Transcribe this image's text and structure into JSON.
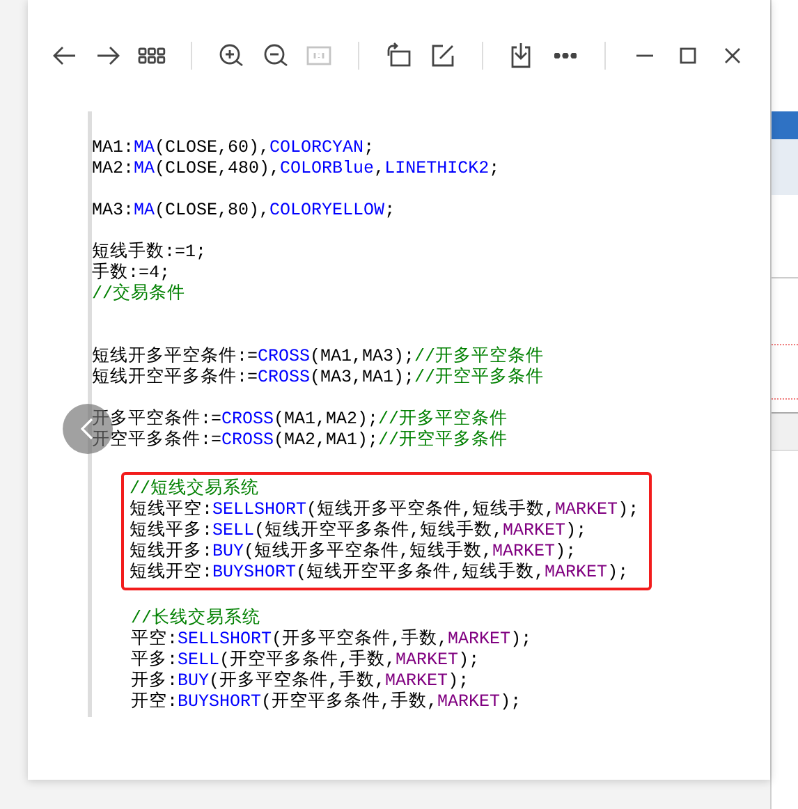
{
  "toolbar": {
    "groups": [
      [
        {
          "kind": "back",
          "disabled": false
        },
        {
          "kind": "forward",
          "disabled": false
        },
        {
          "kind": "thumbnails",
          "disabled": false
        }
      ],
      [
        {
          "kind": "zoom_in",
          "disabled": false
        },
        {
          "kind": "zoom_out",
          "disabled": false
        },
        {
          "kind": "actual_size",
          "disabled": true
        }
      ],
      [
        {
          "kind": "rotate",
          "disabled": false
        },
        {
          "kind": "edit",
          "disabled": false
        }
      ],
      [
        {
          "kind": "save",
          "disabled": false
        }
      ]
    ],
    "window_controls": [
      {
        "kind": "more",
        "disabled": false
      },
      {
        "kind": "minimize",
        "disabled": false
      },
      {
        "kind": "maximize",
        "disabled": false
      },
      {
        "kind": "close",
        "disabled": false
      }
    ]
  },
  "document": {
    "blocks": [
      {
        "indented": false,
        "highlighted": false,
        "lines": [
          {
            "kind": "code",
            "segments": [
              {
                "kind": "plain",
                "text": "MA1:"
              },
              {
                "kind": "function",
                "text": "MA"
              },
              {
                "kind": "plain",
                "text": "(CLOSE,60),"
              },
              {
                "kind": "function",
                "text": "COLORCYAN"
              },
              {
                "kind": "plain",
                "text": ";"
              }
            ]
          },
          {
            "kind": "code",
            "segments": [
              {
                "kind": "plain",
                "text": "MA2:"
              },
              {
                "kind": "function",
                "text": "MA"
              },
              {
                "kind": "plain",
                "text": "(CLOSE,480),"
              },
              {
                "kind": "function",
                "text": "COLORBlue"
              },
              {
                "kind": "plain",
                "text": ","
              },
              {
                "kind": "function",
                "text": "LINETHICK2"
              },
              {
                "kind": "plain",
                "text": ";"
              }
            ]
          },
          {
            "kind": "blank"
          },
          {
            "kind": "code",
            "segments": [
              {
                "kind": "plain",
                "text": "MA3:"
              },
              {
                "kind": "function",
                "text": "MA"
              },
              {
                "kind": "plain",
                "text": "(CLOSE,80),"
              },
              {
                "kind": "function",
                "text": "COLORYELLOW"
              },
              {
                "kind": "plain",
                "text": ";"
              }
            ]
          },
          {
            "kind": "blank"
          },
          {
            "kind": "code",
            "segments": [
              {
                "kind": "plain",
                "text": "短线手数:=1;"
              }
            ]
          },
          {
            "kind": "code",
            "segments": [
              {
                "kind": "plain",
                "text": "手数:=4;"
              }
            ]
          },
          {
            "kind": "code",
            "segments": [
              {
                "kind": "comment",
                "text": "//交易条件"
              }
            ]
          },
          {
            "kind": "blank"
          },
          {
            "kind": "blank"
          },
          {
            "kind": "code",
            "segments": [
              {
                "kind": "plain",
                "text": "短线开多平空条件:="
              },
              {
                "kind": "function",
                "text": "CROSS"
              },
              {
                "kind": "plain",
                "text": "(MA1,MA3);"
              },
              {
                "kind": "comment",
                "text": "//开多平空条件"
              }
            ]
          },
          {
            "kind": "code",
            "segments": [
              {
                "kind": "plain",
                "text": "短线开空平多条件:="
              },
              {
                "kind": "function",
                "text": "CROSS"
              },
              {
                "kind": "plain",
                "text": "(MA3,MA1);"
              },
              {
                "kind": "comment",
                "text": "//开空平多条件"
              }
            ]
          },
          {
            "kind": "blank"
          },
          {
            "kind": "code",
            "segments": [
              {
                "kind": "plain",
                "text": "开多平空条件:="
              },
              {
                "kind": "function",
                "text": "CROSS"
              },
              {
                "kind": "plain",
                "text": "(MA1,MA2);"
              },
              {
                "kind": "comment",
                "text": "//开多平空条件"
              }
            ]
          },
          {
            "kind": "code",
            "segments": [
              {
                "kind": "plain",
                "text": "开空平多条件:="
              },
              {
                "kind": "function",
                "text": "CROSS"
              },
              {
                "kind": "plain",
                "text": "(MA2,MA1);"
              },
              {
                "kind": "comment",
                "text": "//开空平多条件"
              }
            ]
          }
        ]
      },
      {
        "indented": true,
        "highlighted": true,
        "lines": [
          {
            "kind": "code",
            "segments": [
              {
                "kind": "comment",
                "text": "//短线交易系统"
              }
            ]
          },
          {
            "kind": "code",
            "segments": [
              {
                "kind": "plain",
                "text": "短线平空:"
              },
              {
                "kind": "function",
                "text": "SELLSHORT"
              },
              {
                "kind": "plain",
                "text": "(短线开多平空条件,短线手数,"
              },
              {
                "kind": "constant",
                "text": "MARKET"
              },
              {
                "kind": "plain",
                "text": ");"
              }
            ]
          },
          {
            "kind": "code",
            "segments": [
              {
                "kind": "plain",
                "text": "短线平多:"
              },
              {
                "kind": "function",
                "text": "SELL"
              },
              {
                "kind": "plain",
                "text": "(短线开空平多条件,短线手数,"
              },
              {
                "kind": "constant",
                "text": "MARKET"
              },
              {
                "kind": "plain",
                "text": ");"
              }
            ]
          },
          {
            "kind": "code",
            "segments": [
              {
                "kind": "plain",
                "text": "短线开多:"
              },
              {
                "kind": "function",
                "text": "BUY"
              },
              {
                "kind": "plain",
                "text": "(短线开多平空条件,短线手数,"
              },
              {
                "kind": "constant",
                "text": "MARKET"
              },
              {
                "kind": "plain",
                "text": ");"
              }
            ]
          },
          {
            "kind": "code",
            "segments": [
              {
                "kind": "plain",
                "text": "短线开空:"
              },
              {
                "kind": "function",
                "text": "BUYSHORT"
              },
              {
                "kind": "plain",
                "text": "(短线开空平多条件,短线手数,"
              },
              {
                "kind": "constant",
                "text": "MARKET"
              },
              {
                "kind": "plain",
                "text": ");"
              }
            ]
          }
        ]
      },
      {
        "indented": true,
        "highlighted": false,
        "lines": [
          {
            "kind": "code",
            "segments": [
              {
                "kind": "comment",
                "text": "//长线交易系统"
              }
            ]
          },
          {
            "kind": "code",
            "segments": [
              {
                "kind": "plain",
                "text": "平空:"
              },
              {
                "kind": "function",
                "text": "SELLSHORT"
              },
              {
                "kind": "plain",
                "text": "(开多平空条件,手数,"
              },
              {
                "kind": "constant",
                "text": "MARKET"
              },
              {
                "kind": "plain",
                "text": ");"
              }
            ]
          },
          {
            "kind": "code",
            "segments": [
              {
                "kind": "plain",
                "text": "平多:"
              },
              {
                "kind": "function",
                "text": "SELL"
              },
              {
                "kind": "plain",
                "text": "(开空平多条件,手数,"
              },
              {
                "kind": "constant",
                "text": "MARKET"
              },
              {
                "kind": "plain",
                "text": ");"
              }
            ]
          },
          {
            "kind": "code",
            "segments": [
              {
                "kind": "plain",
                "text": "开多:"
              },
              {
                "kind": "function",
                "text": "BUY"
              },
              {
                "kind": "plain",
                "text": "(开多平空条件,手数,"
              },
              {
                "kind": "constant",
                "text": "MARKET"
              },
              {
                "kind": "plain",
                "text": ");"
              }
            ]
          },
          {
            "kind": "code",
            "segments": [
              {
                "kind": "plain",
                "text": "开空:"
              },
              {
                "kind": "function",
                "text": "BUYSHORT"
              },
              {
                "kind": "plain",
                "text": "(开空平多条件,手数,"
              },
              {
                "kind": "constant",
                "text": "MARKET"
              },
              {
                "kind": "plain",
                "text": ");"
              }
            ]
          }
        ]
      }
    ]
  }
}
